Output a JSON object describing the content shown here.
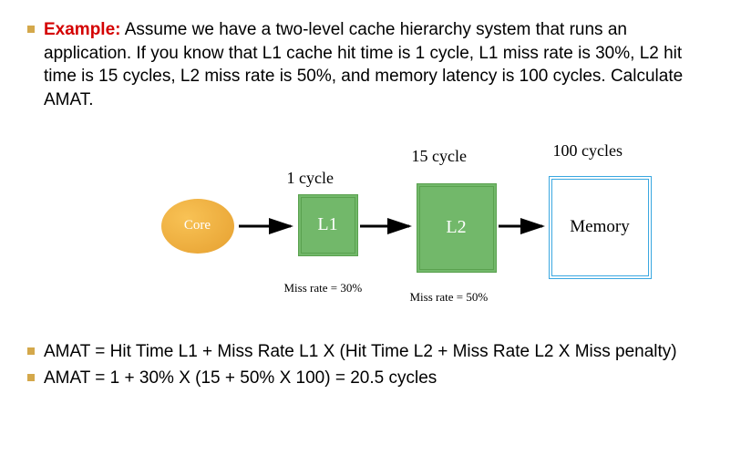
{
  "example_label": "Example:",
  "problem_text": " Assume we have a two-level cache hierarchy system that runs an application. If you know that L1 cache hit time is 1 cycle, L1 miss rate is 30%, L2 hit time is 15 cycles, L2 miss rate is 50%, and memory latency is 100 cycles. Calculate AMAT.",
  "diagram": {
    "core_label": "Core",
    "l1_label": "L1",
    "l2_label": "L2",
    "memory_label": "Memory",
    "l1_hit_time": "1 cycle",
    "l2_hit_time": "15 cycle",
    "memory_latency": "100 cycles",
    "l1_miss_rate": "Miss rate = 30%",
    "l2_miss_rate": "Miss rate = 50%"
  },
  "formula": "AMAT = Hit Time L1 + Miss Rate L1 X (Hit Time L2 + Miss Rate L2 X Miss penalty)",
  "calculation": "AMAT = 1 + 30% X (15 + 50% X 100)  = 20.5 cycles",
  "chart_data": {
    "type": "table",
    "title": "Two-level cache hierarchy AMAT example",
    "nodes": [
      {
        "name": "Core"
      },
      {
        "name": "L1",
        "hit_time_cycles": 1,
        "miss_rate_percent": 30
      },
      {
        "name": "L2",
        "hit_time_cycles": 15,
        "miss_rate_percent": 50
      },
      {
        "name": "Memory",
        "latency_cycles": 100
      }
    ],
    "amat_cycles": 20.5
  }
}
